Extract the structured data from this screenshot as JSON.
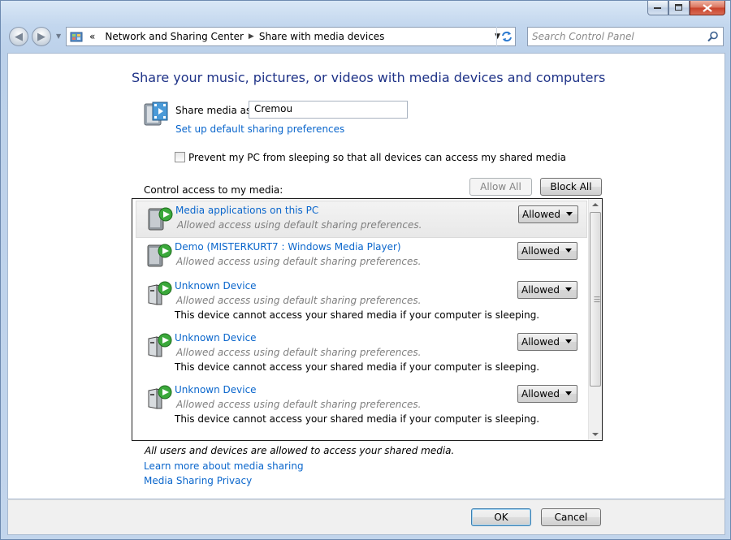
{
  "address": {
    "overflow": "«",
    "crumbs": [
      "Network and Sharing Center",
      "Share with media devices"
    ]
  },
  "search": {
    "placeholder": "Search Control Panel"
  },
  "page": {
    "title": "Share your music, pictures, or videos with media devices and computers",
    "share_as_label": "Share media as:",
    "share_as_value": "Cremou",
    "default_prefs_link": "Set up default sharing preferences",
    "prevent_sleep": "Prevent my PC from sleeping so that all devices can access my shared media",
    "control_access_label": "Control access to my media:",
    "allow_all": "Allow All",
    "block_all": "Block All"
  },
  "devices": [
    {
      "name": "Media applications on this PC",
      "sub": "Allowed access using default sharing preferences.",
      "note": "",
      "access": "Allowed",
      "icon": "media-server-icon"
    },
    {
      "name": "Demo (MISTERKURT7 : Windows Media Player)",
      "sub": "Allowed access using default sharing preferences.",
      "note": "",
      "access": "Allowed",
      "icon": "media-server-icon"
    },
    {
      "name": "Unknown Device",
      "sub": "Allowed access using default sharing preferences.",
      "note": "This device cannot access your shared media if your computer is sleeping.",
      "access": "Allowed",
      "icon": "unknown-device-icon"
    },
    {
      "name": "Unknown Device",
      "sub": "Allowed access using default sharing preferences.",
      "note": "This device cannot access your shared media if your computer is sleeping.",
      "access": "Allowed",
      "icon": "unknown-device-icon"
    },
    {
      "name": "Unknown Device",
      "sub": "Allowed access using default sharing preferences.",
      "note": "This device cannot access your shared media if your computer is sleeping.",
      "access": "Allowed",
      "icon": "unknown-device-icon"
    }
  ],
  "footer": {
    "status": "All users and devices are allowed to access your shared media.",
    "learn_more": "Learn more about media sharing",
    "privacy": "Media Sharing Privacy"
  },
  "buttons": {
    "ok": "OK",
    "cancel": "Cancel"
  },
  "colors": {
    "title": "#1e3287",
    "link": "#0a66cc",
    "play_green": "#3aa83a"
  }
}
